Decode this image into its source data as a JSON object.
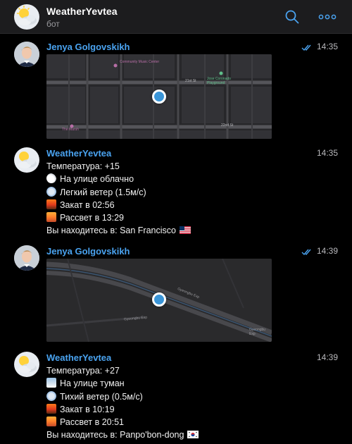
{
  "header": {
    "title": "WeatherYevtea",
    "subtitle": "бот"
  },
  "messages": [
    {
      "sender": "Jenya Golgovskikh",
      "time": "14:35",
      "read": true,
      "map_labels": {
        "community_music": "Community Music Center",
        "jose_playground": "Jose Coronado Playground",
        "the_marsh": "The Marsh",
        "street_21": "21st St",
        "street_22": "22nd St",
        "lexington": "Lexington St",
        "san_carlos": "San Carlos St",
        "capp": "Capp St",
        "van_ness": "S Van Ness Ave",
        "shotwell": "Shotwell St",
        "folsom": "Folsom St"
      }
    },
    {
      "sender": "WeatherYevtea",
      "time": "14:35",
      "lines": [
        "Температура: +15",
        "На улице облачно",
        "Легкий ветер (1.5м/с)",
        "Закат в 02:56",
        "Рассвет в 13:29",
        "Вы находитесь в: San Francisco"
      ]
    },
    {
      "sender": "Jenya Golgovskikh",
      "time": "14:39",
      "read": true,
      "map_labels": {
        "road_1": "Gyeongbu Exp",
        "road_2": "Gyeongbu Exp",
        "road_3": "Gyeongbu Exp"
      }
    },
    {
      "sender": "WeatherYevtea",
      "time": "14:39",
      "lines": [
        "Температура: +27",
        "На улице туман",
        "Тихий ветер (0.5м/с)",
        "Закат в 10:19",
        "Рассвет в 20:51",
        "Вы находитесь в: Panpo'bon-dong"
      ]
    }
  ],
  "colors": {
    "accent": "#4aa3f0",
    "background": "#000000",
    "header": "#1c1c1e",
    "pin": "#3a95d8"
  },
  "icons": {
    "search": "search-icon",
    "more": "more-icon",
    "read": "double-check-icon"
  }
}
